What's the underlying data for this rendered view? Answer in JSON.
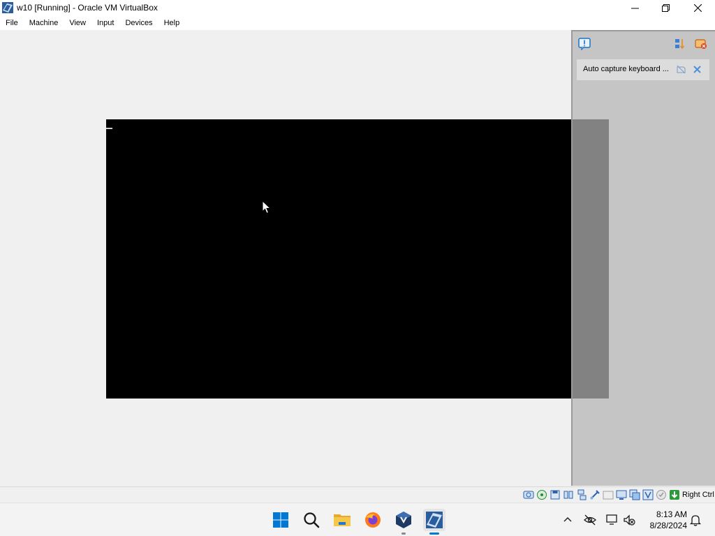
{
  "window": {
    "title": "w10 [Running] - Oracle VM VirtualBox",
    "controls": [
      "minimize",
      "restore",
      "close"
    ]
  },
  "menu": {
    "items": [
      "File",
      "Machine",
      "View",
      "Input",
      "Devices",
      "Help"
    ]
  },
  "notification_center": {
    "top_icons": [
      "notification-center-icon",
      "sort-icon",
      "toggle-notifications-icon"
    ],
    "item": {
      "text": "Auto capture keyboard ...",
      "icons": [
        "do-not-show-again-icon",
        "close-notification-icon"
      ]
    }
  },
  "statusbar": {
    "icons": [
      "hard-disk-icon",
      "optical-drive-icon",
      "floppy-icon",
      "audio-icon",
      "network-icon",
      "usb-icon",
      "shared-folders-icon",
      "display-icon",
      "recording-icon",
      "cpu-icon",
      "mouse-integration-icon",
      "keyboard-capture-icon"
    ],
    "host_key": "Right Ctrl"
  },
  "taskbar": {
    "apps": [
      "start-icon",
      "search-icon",
      "file-explorer-icon",
      "firefox-icon",
      "virtualbox-manager-icon",
      "virtualbox-vm-icon"
    ],
    "tray": [
      "show-hidden-icons-chevron",
      "network-off-icon",
      "display-tray-icon",
      "volume-muted-icon",
      "notifications-bell-icon"
    ],
    "time": "8:13 AM",
    "date": "8/28/2024"
  },
  "colors": {
    "vm_screen": "#000000",
    "accent_blue": "#0078d4"
  }
}
